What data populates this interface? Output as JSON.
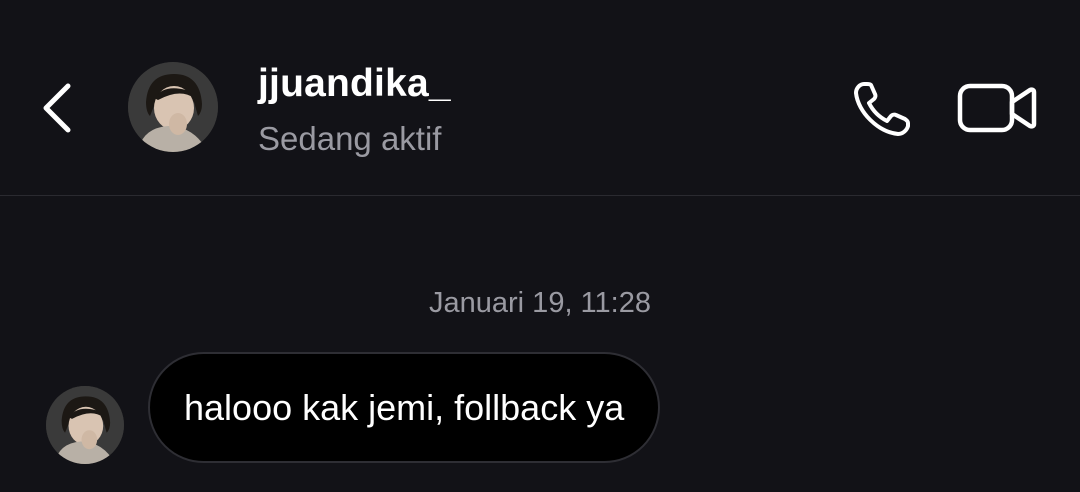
{
  "header": {
    "back_icon": "chevron-left-icon",
    "avatar_icon": "profile-photo",
    "username": "jjuandika_",
    "status": "Sedang aktif",
    "call_icon": "phone-icon",
    "video_icon": "video-camera-icon"
  },
  "conversation": {
    "timestamp": "Januari 19, 11:28",
    "messages": [
      {
        "sender": "jjuandika_",
        "text": "halooo kak jemi, follback ya"
      }
    ]
  },
  "colors": {
    "background": "#121217",
    "bubble": "#000000",
    "bubble_border": "#2e2e34",
    "secondary_text": "#9a9aa2",
    "primary_text": "#ffffff"
  }
}
